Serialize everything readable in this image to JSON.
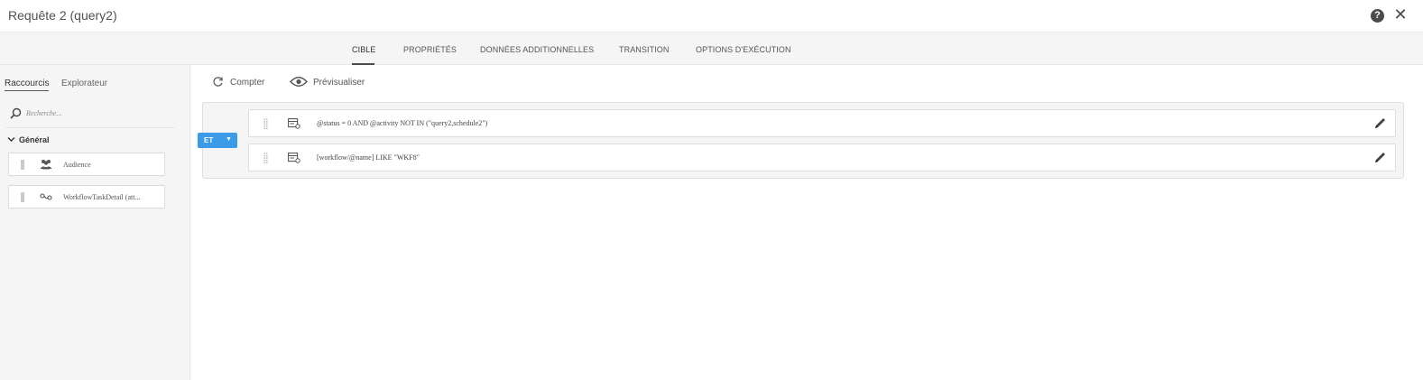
{
  "window": {
    "title": "Requête 2 (query2)"
  },
  "tabs": [
    {
      "label": "CIBLE",
      "active": true
    },
    {
      "label": "PROPRIÉTÉS",
      "active": false
    },
    {
      "label": "DONNÉES ADDITIONNELLES",
      "active": false
    },
    {
      "label": "TRANSITION",
      "active": false
    },
    {
      "label": "OPTIONS D'EXÉCUTION",
      "active": false
    }
  ],
  "left_panel": {
    "tabs": [
      {
        "label": "Raccourcis",
        "active": true
      },
      {
        "label": "Explorateur",
        "active": false
      }
    ],
    "search": {
      "placeholder": "Recherche..."
    },
    "group": {
      "label": "Général",
      "expanded": true
    },
    "items": [
      {
        "label": "Audience",
        "icon": "audience-icon"
      },
      {
        "label": "WorkflowTaskDetail (att...",
        "icon": "link-icon"
      }
    ]
  },
  "toolbar": {
    "count_label": "Compter",
    "preview_label": "Prévisualiser"
  },
  "conditions": {
    "operator": "ET",
    "rows": [
      {
        "expression": "@status = 0 AND @activity NOT IN (\"query2,schedule2\")"
      },
      {
        "expression": "[workflow/@name] LIKE \"WKF8\""
      }
    ]
  },
  "colors": {
    "accent": "#3b9be8",
    "panel_bg": "#f5f5f5",
    "text": "#4b4b4b"
  }
}
